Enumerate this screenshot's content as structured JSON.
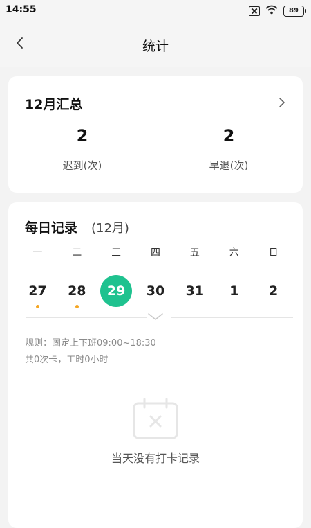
{
  "status": {
    "time": "14:55",
    "battery": "89"
  },
  "header": {
    "title": "统计"
  },
  "summary": {
    "title": "12月汇总",
    "late": {
      "value": "2",
      "label": "迟到(次)"
    },
    "early": {
      "value": "2",
      "label": "早退(次)"
    }
  },
  "daily": {
    "title": "每日记录",
    "month": "(12月)",
    "weekdays": [
      "一",
      "二",
      "三",
      "四",
      "五",
      "六",
      "日"
    ],
    "dates": [
      {
        "day": "27",
        "dot": true
      },
      {
        "day": "28",
        "dot": true
      },
      {
        "day": "29",
        "selected": true
      },
      {
        "day": "30"
      },
      {
        "day": "31"
      },
      {
        "day": "1"
      },
      {
        "day": "2"
      }
    ],
    "rule": "规则：固定上下班09:00~18:30",
    "count": "共0次卡，工时0小时",
    "empty_text": "当天没有打卡记录"
  },
  "colors": {
    "accent": "#1fc28f",
    "dot": "#f5a623"
  }
}
